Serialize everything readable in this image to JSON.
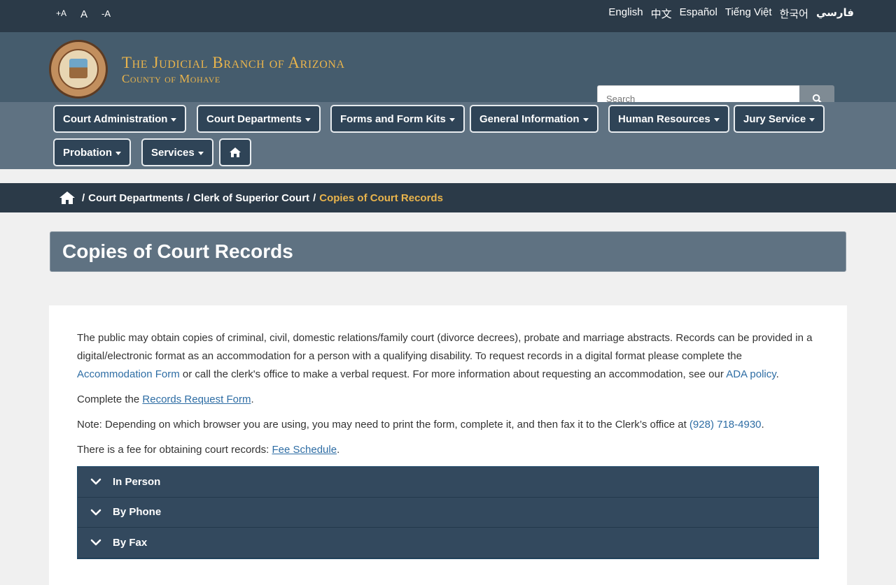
{
  "topbar": {
    "font_sizes": [
      "+A",
      "A",
      "-A"
    ],
    "languages": [
      "English",
      "中文",
      "Español",
      "Tiếng Việt",
      "한국어",
      "فارسي"
    ]
  },
  "header": {
    "title": "The Judicial Branch of Arizona",
    "subtitle": "County of Mohave",
    "search": {
      "placeholder": "Search"
    }
  },
  "nav": {
    "items": [
      "Court Administration",
      "Court Departments",
      "Forms and Form Kits",
      "General Information",
      "Human Resources",
      "Jury Service",
      "Probation",
      "Services"
    ]
  },
  "breadcrumb": {
    "items": [
      "Court Departments",
      "Clerk of Superior Court"
    ],
    "current": "Copies of Court Records"
  },
  "page": {
    "title": "Copies of Court Records",
    "p1_a": "The public may obtain copies of criminal, civil, domestic relations/family court (divorce decrees), probate and marriage abstracts. Records can be provided in a digital/electronic format as an accommodation for a person with a qualifying disability. To request records in a digital format please complete the ",
    "p1_link1": "Accommodation Form",
    "p1_b": " or call the clerk's office to make a verbal request. For more information about requesting an accommodation, see our ",
    "p1_link2": "ADA policy",
    "p1_c": ".",
    "p2_a": "Complete the ",
    "p2_link": "Records Request Form",
    "p2_b": ".",
    "p3_a": "Note: Depending on which browser you are using, you may need to print the form, complete it, and then fax it to the Clerk’s office at ",
    "p3_link": "(928) 718-4930",
    "p3_b": ".",
    "p4_a": "There is a fee for obtaining court records: ",
    "p4_link": "Fee Schedule",
    "p4_b": "."
  },
  "accordion": {
    "items": [
      "In Person",
      "By Phone",
      "By Fax"
    ]
  },
  "colors": {
    "dark_navy": "#2b3a48",
    "header_slate": "#455c6d",
    "nav_slate": "#5f7282",
    "gold": "#e9b44c",
    "link_blue": "#2e6da4"
  }
}
